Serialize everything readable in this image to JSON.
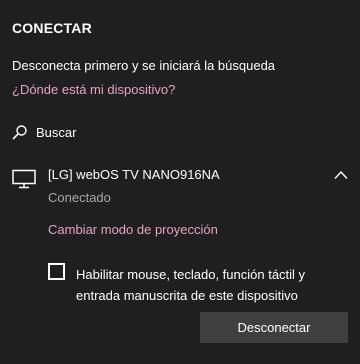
{
  "panel": {
    "title": "CONECTAR",
    "subtitle": "Desconecta primero y se iniciará la búsqueda",
    "help_link": "¿Dónde está mi dispositivo?"
  },
  "search": {
    "icon": "search-icon",
    "label": "Buscar"
  },
  "device": {
    "icon": "tv-icon",
    "name": "[LG] webOS TV NANO916NA",
    "status": "Conectado",
    "expand_icon": "chevron-up-icon",
    "projection_mode_link": "Cambiar modo de proyección",
    "input_checkbox": {
      "checked": false,
      "label": "Habilitar mouse, teclado, función táctil y entrada manuscrita de este dispositivo"
    },
    "disconnect_button": "Desconectar"
  },
  "colors": {
    "background": "#1f1f1f",
    "accent_link": "#e6a4bf",
    "secondary_text": "#a8a8a8",
    "button_bg": "#3f3f3f"
  }
}
